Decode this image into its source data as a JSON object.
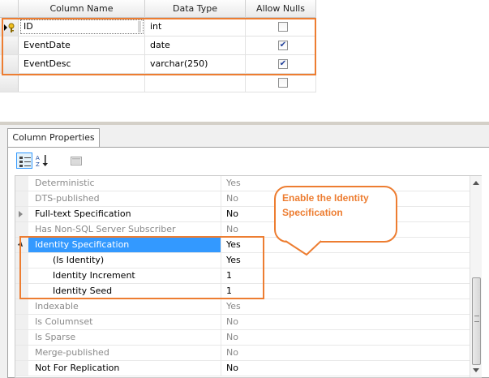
{
  "table_designer": {
    "columns": [
      {
        "key": "name",
        "label": "Column Name"
      },
      {
        "key": "type",
        "label": "Data Type"
      },
      {
        "key": "nulls",
        "label": "Allow Nulls"
      }
    ],
    "rows": [
      {
        "name": "ID",
        "type": "int",
        "allow_nulls": false,
        "primary_key": true
      },
      {
        "name": "EventDate",
        "type": "date",
        "allow_nulls": true
      },
      {
        "name": "EventDesc",
        "type": "varchar(250)",
        "allow_nulls": true
      },
      {
        "name": "",
        "type": "",
        "allow_nulls": false
      }
    ],
    "checkmark": "✔"
  },
  "properties": {
    "tab_label": "Column Properties",
    "toolbar": [
      "categorized-icon",
      "alphabetical-icon",
      "property-pages-icon"
    ],
    "items": [
      {
        "name": "Deterministic",
        "value": "Yes",
        "style": "gray"
      },
      {
        "name": "DTS-published",
        "value": "No",
        "style": "gray"
      },
      {
        "name": "Full-text Specification",
        "value": "No",
        "style": "normal",
        "expander": "collapsed"
      },
      {
        "name": "Has Non-SQL Server Subscriber",
        "value": "No",
        "style": "gray"
      },
      {
        "name": "Identity Specification",
        "value": "Yes",
        "style": "selected",
        "expander": "expanded"
      },
      {
        "name": "(Is Identity)",
        "value": "Yes",
        "style": "child"
      },
      {
        "name": "Identity Increment",
        "value": "1",
        "style": "child"
      },
      {
        "name": "Identity Seed",
        "value": "1",
        "style": "child"
      },
      {
        "name": "Indexable",
        "value": "Yes",
        "style": "gray"
      },
      {
        "name": "Is Columnset",
        "value": "No",
        "style": "gray"
      },
      {
        "name": "Is Sparse",
        "value": "No",
        "style": "gray"
      },
      {
        "name": "Merge-published",
        "value": "No",
        "style": "gray"
      },
      {
        "name": "Not For Replication",
        "value": "No",
        "style": "normal"
      }
    ]
  },
  "callout": {
    "text": "Enable the Identity Specification"
  },
  "colors": {
    "highlight": "#ed7d31",
    "selection": "#3399ff",
    "grayed": "#8a8a8a"
  }
}
